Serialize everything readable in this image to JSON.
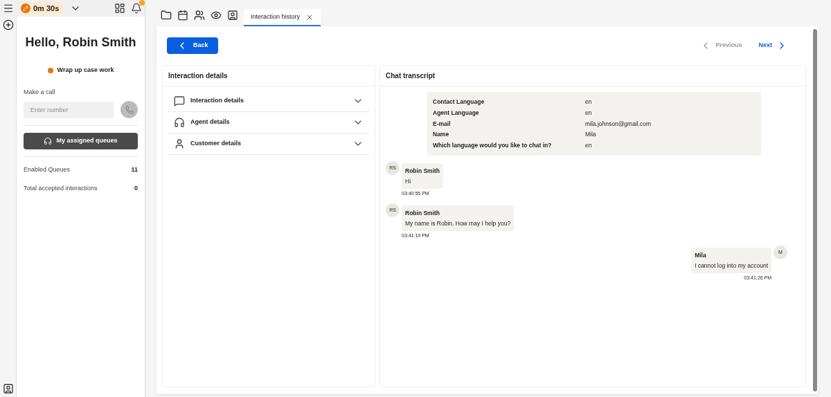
{
  "top_bar": {
    "timer": "0m 30s",
    "notification_dot": true
  },
  "greeting": "Hello, Robin Smith",
  "status": {
    "label": "Wrap up case work",
    "color": "#e07a10"
  },
  "make_call": {
    "label": "Make a call",
    "placeholder": "Enter number",
    "call_disabled": true
  },
  "queues_button": "My assigned queues",
  "stats": [
    {
      "label": "Enabled Queues",
      "value": "11"
    },
    {
      "label": "Total accepted interactions",
      "value": "0"
    }
  ],
  "tabs": [
    {
      "label": "Interaction history",
      "selected": true
    }
  ],
  "nav": {
    "back": "Back",
    "previous": "Previous",
    "previous_disabled": true,
    "next": "Next",
    "next_disabled": false
  },
  "details_panel": {
    "title": "Interaction details",
    "sections": [
      {
        "kind": "chat",
        "label": "Interaction details",
        "expanded": false
      },
      {
        "kind": "agent",
        "label": "Agent details",
        "expanded": false
      },
      {
        "kind": "customer",
        "label": "Customer details",
        "expanded": false
      }
    ]
  },
  "transcript": {
    "title": "Chat transcript",
    "info": [
      {
        "label": "Contact Language",
        "value": "en"
      },
      {
        "label": "Agent Language",
        "value": "en"
      },
      {
        "label": "E-mail",
        "value": "mila.johnson@gmail.com"
      },
      {
        "label": "Name",
        "value": "Mila"
      },
      {
        "label": "Which language would you like to chat in?",
        "value": "en"
      }
    ],
    "messages": [
      {
        "kind": "outgoing",
        "initials": "RS",
        "sender": "Robin Smith",
        "text": "Hi",
        "time": "03:40:55 PM"
      },
      {
        "kind": "outgoing",
        "initials": "RS",
        "sender": "Robin Smith",
        "text": "My name is Robin. How may I help you?",
        "time": "03:41:19 PM"
      },
      {
        "kind": "incoming",
        "initials": "M",
        "sender": "Mila",
        "text": "I cannot log into my account",
        "time": "03:41:26 PM"
      }
    ]
  }
}
